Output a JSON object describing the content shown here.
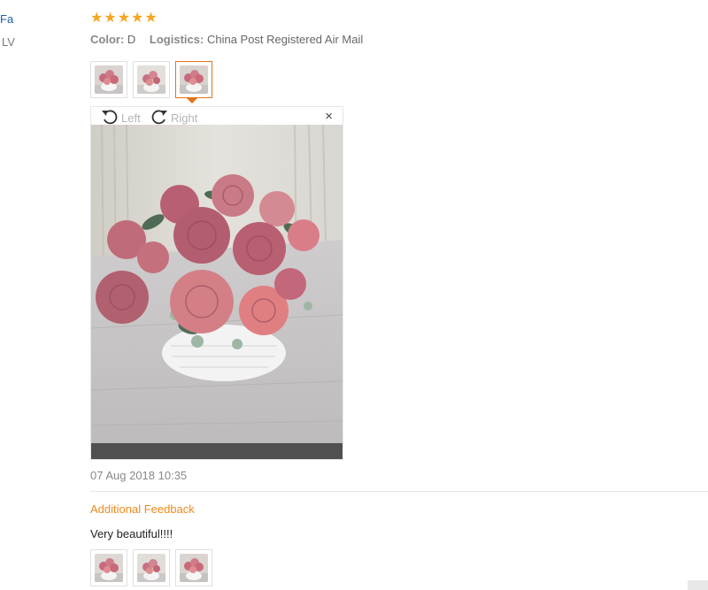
{
  "buyer": {
    "name": "Fa",
    "country": "LV"
  },
  "rating": {
    "stars": 5,
    "max": 5,
    "color": "#f5a623"
  },
  "order": {
    "color_label": "Color:",
    "color_value": "D",
    "logistics_label": "Logistics:",
    "logistics_value": "China Post Registered Air Mail"
  },
  "thumbnails": {
    "count": 3,
    "active_index": 2,
    "icons": [
      "flower-photo-icon",
      "flower-photo-icon",
      "flower-photo-icon"
    ]
  },
  "viewer": {
    "rotate_left_label": "Left",
    "rotate_right_label": "Right",
    "close_label": "×"
  },
  "review_date": "07 Aug 2018 10:35",
  "additional_feedback": {
    "title": "Additional Feedback",
    "text": "Very beautiful!!!!",
    "thumbnail_count": 3
  },
  "colors": {
    "link": "#1a5dad",
    "accent": "#e6731a",
    "feedback_title": "#f08a1c"
  }
}
